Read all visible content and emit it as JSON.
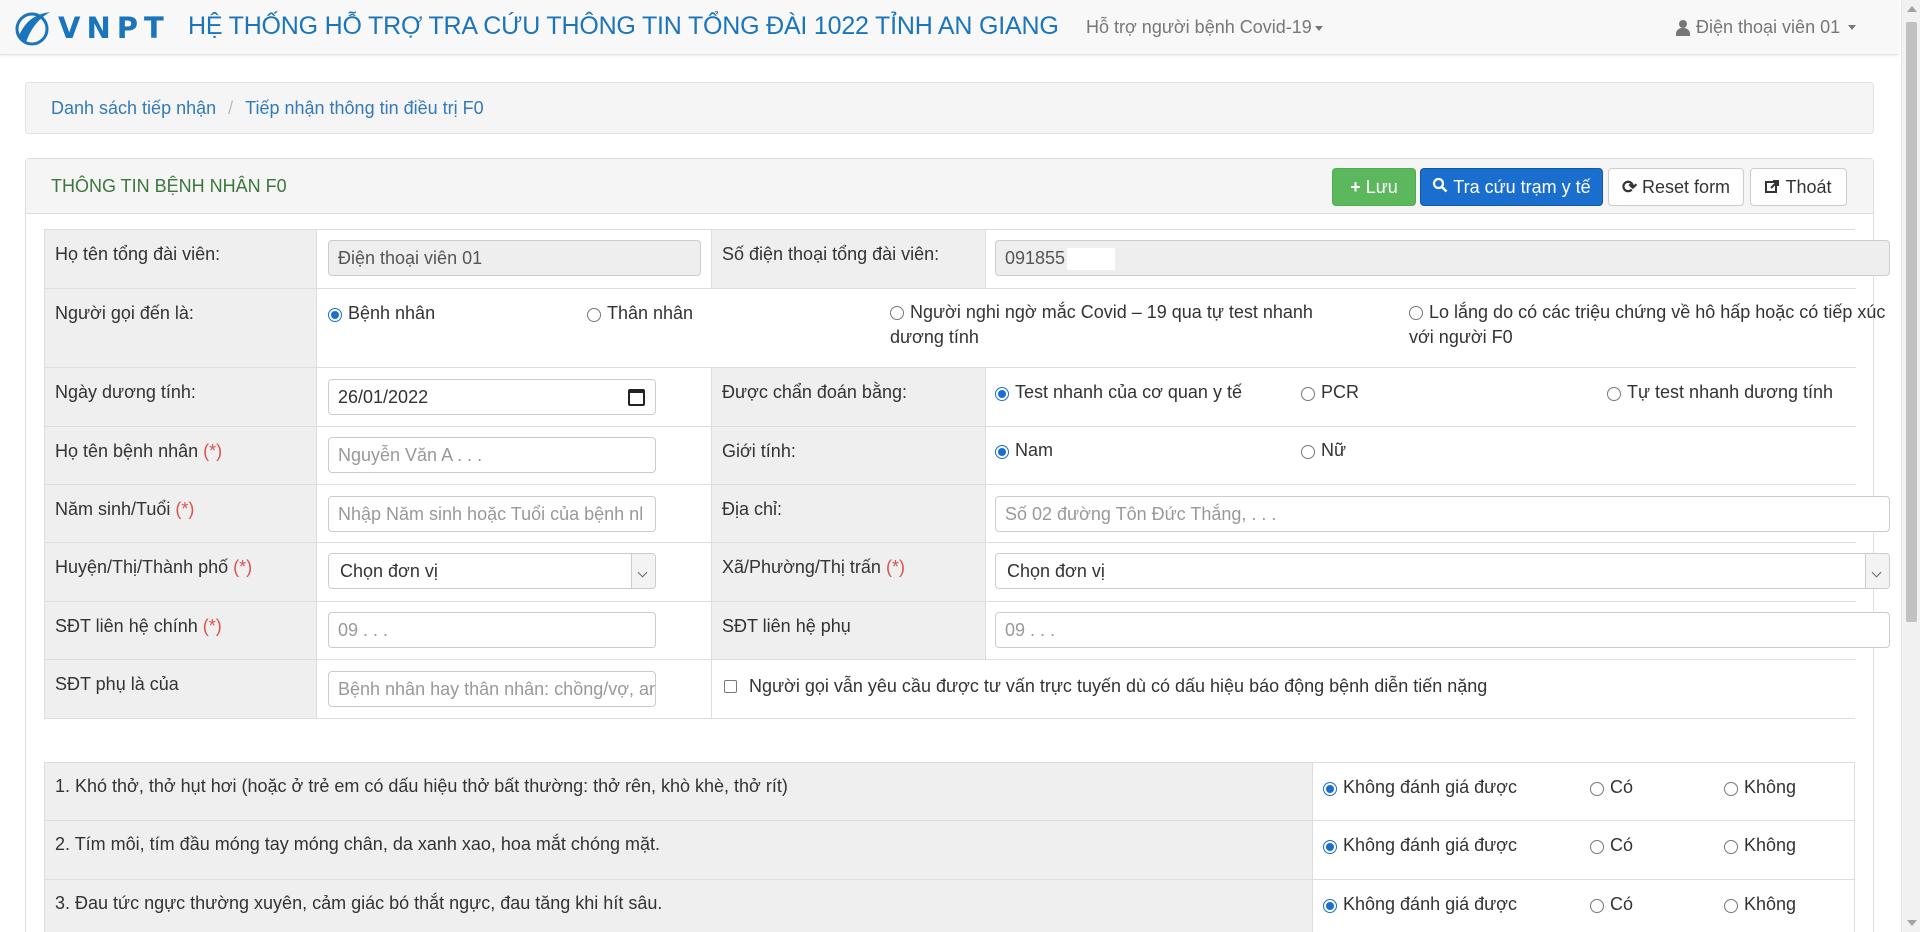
{
  "navbar": {
    "brand_text": "VNPT",
    "title": "HỆ THỐNG HỖ TRỢ TRA CỨU THÔNG TIN TỔNG ĐÀI 1022 TỈNH AN GIANG",
    "menu_dropdown": "Hỗ trợ người bệnh Covid-19",
    "user_name": "Điện thoại viên 01",
    "brand_color": "#1a75bc"
  },
  "breadcrumb": {
    "items": [
      "Danh sách tiếp nhận",
      "Tiếp nhận thông tin điều trị F0"
    ]
  },
  "panel": {
    "title": "THÔNG TIN BỆNH NHÂN F0",
    "buttons": {
      "save": "Lưu",
      "lookup": "Tra cứu trạm y tế",
      "reset": "Reset form",
      "exit": "Thoát"
    }
  },
  "form": {
    "operator_name_label": "Họ tên tổng đài viên:",
    "operator_name_value": "Điện thoại viên 01",
    "operator_phone_label": "Số điện thoại tổng đài viên:",
    "operator_phone_value": "091855",
    "caller_label": "Người gọi đến là:",
    "caller_options": [
      {
        "label": "Bệnh nhân",
        "checked": true
      },
      {
        "label": "Thân nhân",
        "checked": false
      },
      {
        "label": "Người nghi ngờ mắc Covid – 19 qua tự test nhanh dương tính",
        "checked": false
      },
      {
        "label": "Lo lắng do có các triệu chứng về hô hấp hoặc có tiếp xúc với người F0",
        "checked": false
      }
    ],
    "positive_date_label": "Ngày dương tính:",
    "positive_date_value": "26/01/2022",
    "diagnosed_label": "Được chẩn đoán bằng:",
    "diagnosed_options": [
      {
        "label": "Test nhanh của cơ quan y tế",
        "checked": true
      },
      {
        "label": "PCR",
        "checked": false
      },
      {
        "label": "Tự test nhanh dương tính",
        "checked": false
      }
    ],
    "patient_name_label": "Họ tên bệnh nhân",
    "patient_name_placeholder": "Nguyễn Văn A . . .",
    "gender_label": "Giới tính:",
    "gender_options": [
      {
        "label": "Nam",
        "checked": true
      },
      {
        "label": "Nữ",
        "checked": false
      }
    ],
    "birth_label": "Năm sinh/Tuổi",
    "birth_placeholder": "Nhập Năm sinh hoặc Tuổi của bệnh nl",
    "address_label": "Địa chỉ:",
    "address_placeholder": "Số 02 đường Tôn Đức Thắng, . . .",
    "district_label": "Huyện/Thị/Thành phố",
    "district_value": "Chọn đơn vị",
    "ward_label": "Xã/Phường/Thị trấn",
    "ward_value": "Chọn đơn vị",
    "main_phone_label": "SĐT liên hệ chính",
    "main_phone_placeholder": "09 . . .",
    "sub_phone_label": "SĐT liên hệ phụ",
    "sub_phone_placeholder": "09 . . .",
    "sub_phone_owner_label": "SĐT phụ là của",
    "sub_phone_owner_placeholder": "Bệnh nhân hay thân nhân: chồng/vợ, anh",
    "online_consult_label": "Người gọi vẫn yêu cầu được tư vấn trực tuyến dù có dấu hiệu báo động bệnh diễn tiến nặng",
    "required_mark": "(*)"
  },
  "symptoms": [
    {
      "question": "1. Khó thở, thở hụt hơi (hoặc ở trẻ em có dấu hiệu thở bất thường: thở rên, khò khè, thở rít)",
      "options": [
        "Không đánh giá được",
        "Có",
        "Không"
      ],
      "selected": 0
    },
    {
      "question": "2. Tím môi, tím đầu móng tay móng chân, da xanh xao, hoa mắt chóng mặt.",
      "options": [
        "Không đánh giá được",
        "Có",
        "Không"
      ],
      "selected": 0
    },
    {
      "question": "3. Đau tức ngực thường xuyên, cảm giác bó thắt ngực, đau tăng khi hít sâu.",
      "options": [
        "Không đánh giá được",
        "Có",
        "Không"
      ],
      "selected": 0
    }
  ]
}
